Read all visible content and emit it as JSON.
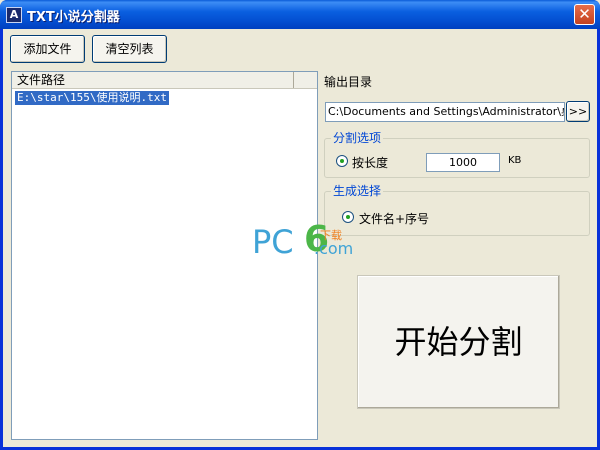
{
  "window": {
    "title": "TXT小说分割器",
    "app_icon_glyph": "A",
    "close_glyph": "✕"
  },
  "toolbar": {
    "add_file_label": "添加文件",
    "clear_list_label": "清空列表"
  },
  "file_list": {
    "columns": [
      "文件路径",
      ""
    ],
    "rows": [
      {
        "path": "E:\\star\\155\\使用说明.txt",
        "selected": true
      }
    ]
  },
  "output": {
    "label": "输出目录",
    "path_value": "C:\\Documents and Settings\\Administrator\\桌",
    "browse_label": ">>"
  },
  "split_options": {
    "legend": "分割选项",
    "by_length_label": "按长度",
    "length_value": "1000",
    "unit": "KB"
  },
  "generate_options": {
    "legend": "生成选择",
    "naming_label": "文件名+序号"
  },
  "watermark": {
    "text_pc": "PC",
    "text_6": "6",
    "text_cn": "下载",
    "text_com": ".com"
  },
  "start_button_label": "开始分割",
  "colors": {
    "selection": "#316ac5",
    "legend_blue": "#0046d5",
    "titlebar_blue": "#0450d2"
  }
}
